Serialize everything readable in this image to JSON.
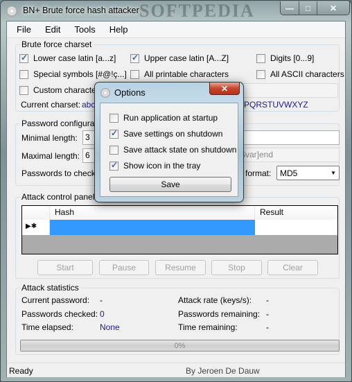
{
  "window": {
    "title": "BN+ Brute force hash attacker",
    "watermark": "SOFTPEDIA",
    "caption_buttons": {
      "minimize": "—",
      "maximize": "□",
      "close": "✕"
    }
  },
  "menu": [
    "File",
    "Edit",
    "Tools",
    "Help"
  ],
  "charset": {
    "legend": "Brute force charset",
    "options": [
      {
        "label": "Lower case latin [a...z]",
        "checked": true
      },
      {
        "label": "Upper case latin [A...Z]",
        "checked": true
      },
      {
        "label": "Digits [0...9]",
        "checked": false
      },
      {
        "label": "Special symbols [#@!ç...]",
        "checked": false
      },
      {
        "label": "All printable characters",
        "checked": false
      },
      {
        "label": "All ASCII characters",
        "checked": false
      },
      {
        "label": "Custom character set",
        "checked": false
      }
    ],
    "custom_value": "",
    "current_label": "Current charset:",
    "current_value_start": "abc",
    "current_value_end": "PQRSTUVWXYZ"
  },
  "password_config": {
    "legend": "Password configuration",
    "min_label": "Minimal length:",
    "min_value": "3",
    "max_label": "Maximal length:",
    "max_value": "6",
    "to_check_label": "Passwords to check:",
    "pattern_value": "",
    "pattern_placeholder": "[$var]end",
    "format_label": "format:",
    "format_value": "MD5"
  },
  "attack_panel": {
    "legend": "Attack control panel",
    "columns": [
      "",
      "Hash",
      "Result"
    ],
    "rows": [
      {
        "marker": "▶✱",
        "hash": "",
        "result": ""
      }
    ],
    "buttons": [
      "Start",
      "Pause",
      "Resume",
      "Stop",
      "Clear"
    ]
  },
  "stats": {
    "legend": "Attack statistics",
    "current_password_label": "Current password:",
    "current_password": "-",
    "checked_label": "Passwords checked:",
    "checked": "0",
    "elapsed_label": "Time elapsed:",
    "elapsed": "None",
    "rate_label": "Attack rate (keys/s):",
    "rate": "-",
    "remaining_label": "Passwords remaining:",
    "remaining": "-",
    "time_remaining_label": "Time remaining:",
    "time_remaining": "-",
    "progress_percent": 0,
    "progress_text": "0%"
  },
  "statusbar": {
    "status": "Ready",
    "author": "By Jeroen De Dauw"
  },
  "options_dialog": {
    "title": "Options",
    "close": "✕",
    "options": [
      {
        "label": "Run application at startup",
        "checked": false
      },
      {
        "label": "Save settings on shutdown",
        "checked": true
      },
      {
        "label": "Save attack state on shutdown",
        "checked": false
      },
      {
        "label": "Show icon in the tray",
        "checked": true
      }
    ],
    "save_label": "Save"
  }
}
